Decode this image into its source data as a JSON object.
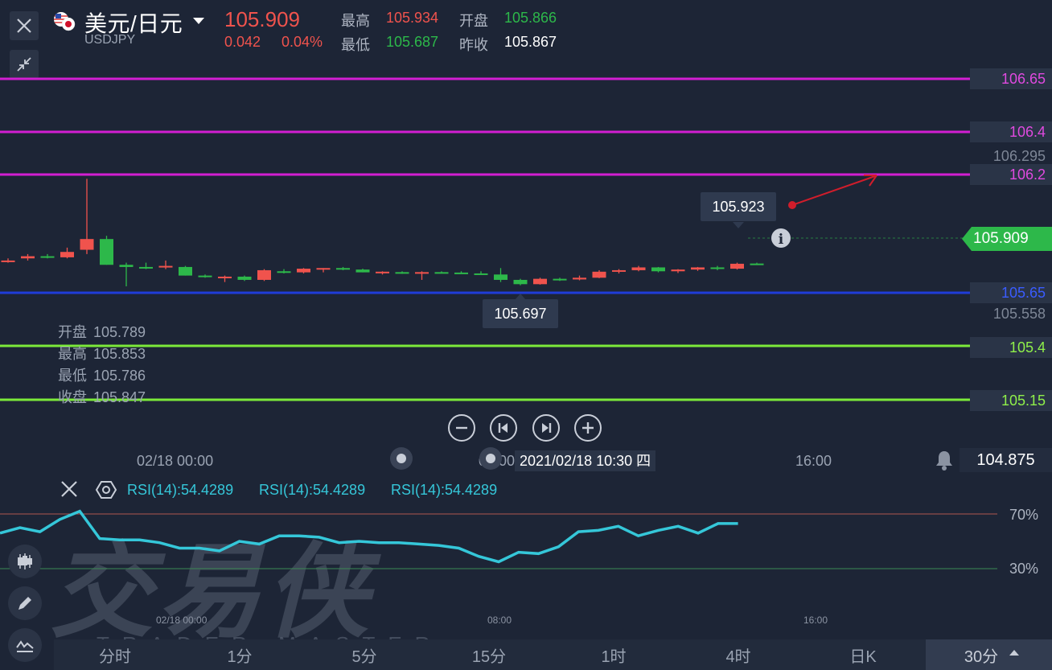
{
  "header": {
    "pair_name": "美元/日元",
    "symbol": "USDJPY",
    "last_price": "105.909",
    "change": "0.042",
    "change_pct": "0.04%",
    "high_label": "最高",
    "high_value": "105.934",
    "low_label": "最低",
    "low_value": "105.687",
    "open_label": "开盘",
    "open_value": "105.866",
    "prev_close_label": "昨收",
    "prev_close_value": "105.867"
  },
  "price_levels": [
    {
      "value": "106.65",
      "color": "#d21ed2",
      "text_color": "#e04ae0"
    },
    {
      "value": "106.4",
      "color": "#d21ed2",
      "text_color": "#e04ae0"
    },
    {
      "value": "106.2",
      "color": "#d21ed2",
      "text_color": "#e04ae0"
    },
    {
      "value": "105.65",
      "color": "#1f3cd8",
      "text_color": "#3a5cff"
    },
    {
      "value": "105.4",
      "color": "#7cea3a",
      "text_color": "#8ff04a"
    },
    {
      "value": "105.15",
      "color": "#7cea3a",
      "text_color": "#8ff04a"
    }
  ],
  "axis_values": {
    "upper": "106.295",
    "lower": "105.558"
  },
  "current_price_tag": "105.909",
  "high_bubble": "105.923",
  "low_bubble": "105.697",
  "ohlc_panel": {
    "open_label": "开盘",
    "open": "105.789",
    "high_label": "最高",
    "high": "105.853",
    "low_label": "最低",
    "low": "105.786",
    "close_label": "收盘",
    "close": "105.847"
  },
  "time_axis": {
    "t1": "02/18 00:00",
    "t2": "08:00",
    "t3": "16:00"
  },
  "cursor_time": "2021/02/18 10:30 四",
  "alert_price": "104.875",
  "rsi": {
    "label1": "RSI(14):54.4289",
    "label2": "RSI(14):54.4289",
    "label3": "RSI(14):54.4289",
    "level_high": "70%",
    "level_low": "30%",
    "line_color": "#35c7d9",
    "x_labels": {
      "t1": "02/18 00:00",
      "t2": "08:00",
      "t3": "16:00"
    }
  },
  "watermark": {
    "main": "交易侠",
    "sub": "TRADER MASTER"
  },
  "timeframes": [
    "分时",
    "1分",
    "5分",
    "15分",
    "1时",
    "4时",
    "日K"
  ],
  "active_timeframe": "30分",
  "colors": {
    "up": "#f0534d",
    "down": "#2db84a",
    "background": "#1d2536"
  },
  "candles": [
    {
      "o": 105.8,
      "h": 105.81,
      "l": 105.79,
      "c": 105.8,
      "up": true
    },
    {
      "o": 105.81,
      "h": 105.83,
      "l": 105.8,
      "c": 105.82,
      "up": true
    },
    {
      "o": 105.82,
      "h": 105.83,
      "l": 105.81,
      "c": 105.815,
      "up": false
    },
    {
      "o": 105.815,
      "h": 105.86,
      "l": 105.81,
      "c": 105.84,
      "up": true
    },
    {
      "o": 105.85,
      "h": 106.18,
      "l": 105.83,
      "c": 105.9,
      "up": true
    },
    {
      "o": 105.9,
      "h": 105.915,
      "l": 105.78,
      "c": 105.78,
      "up": false
    },
    {
      "o": 105.78,
      "h": 105.79,
      "l": 105.68,
      "c": 105.77,
      "up": false
    },
    {
      "o": 105.77,
      "h": 105.79,
      "l": 105.76,
      "c": 105.77,
      "up": false
    },
    {
      "o": 105.77,
      "h": 105.8,
      "l": 105.76,
      "c": 105.775,
      "up": true
    },
    {
      "o": 105.77,
      "h": 105.775,
      "l": 105.73,
      "c": 105.73,
      "up": false
    },
    {
      "o": 105.73,
      "h": 105.735,
      "l": 105.72,
      "c": 105.727,
      "up": false
    },
    {
      "o": 105.725,
      "h": 105.73,
      "l": 105.7,
      "c": 105.723,
      "up": true
    },
    {
      "o": 105.725,
      "h": 105.73,
      "l": 105.705,
      "c": 105.71,
      "up": false
    },
    {
      "o": 105.71,
      "h": 105.76,
      "l": 105.705,
      "c": 105.755,
      "up": true
    },
    {
      "o": 105.75,
      "h": 105.76,
      "l": 105.74,
      "c": 105.745,
      "up": false
    },
    {
      "o": 105.745,
      "h": 105.765,
      "l": 105.74,
      "c": 105.762,
      "up": true
    },
    {
      "o": 105.762,
      "h": 105.765,
      "l": 105.745,
      "c": 105.765,
      "up": true
    },
    {
      "o": 105.765,
      "h": 105.77,
      "l": 105.755,
      "c": 105.758,
      "up": false
    },
    {
      "o": 105.758,
      "h": 105.762,
      "l": 105.745,
      "c": 105.745,
      "up": false
    },
    {
      "o": 105.745,
      "h": 105.75,
      "l": 105.735,
      "c": 105.748,
      "up": true
    },
    {
      "o": 105.746,
      "h": 105.75,
      "l": 105.738,
      "c": 105.742,
      "up": false
    },
    {
      "o": 105.745,
      "h": 105.75,
      "l": 105.71,
      "c": 105.746,
      "up": true
    },
    {
      "o": 105.746,
      "h": 105.75,
      "l": 105.74,
      "c": 105.744,
      "up": false
    },
    {
      "o": 105.744,
      "h": 105.75,
      "l": 105.738,
      "c": 105.74,
      "up": false
    },
    {
      "o": 105.74,
      "h": 105.75,
      "l": 105.735,
      "c": 105.738,
      "up": false
    },
    {
      "o": 105.735,
      "h": 105.765,
      "l": 105.7,
      "c": 105.71,
      "up": false
    },
    {
      "o": 105.71,
      "h": 105.715,
      "l": 105.685,
      "c": 105.69,
      "up": false
    },
    {
      "o": 105.69,
      "h": 105.72,
      "l": 105.688,
      "c": 105.715,
      "up": true
    },
    {
      "o": 105.715,
      "h": 105.72,
      "l": 105.705,
      "c": 105.712,
      "up": false
    },
    {
      "o": 105.712,
      "h": 105.73,
      "l": 105.708,
      "c": 105.72,
      "up": true
    },
    {
      "o": 105.72,
      "h": 105.755,
      "l": 105.718,
      "c": 105.748,
      "up": true
    },
    {
      "o": 105.748,
      "h": 105.76,
      "l": 105.74,
      "c": 105.755,
      "up": true
    },
    {
      "o": 105.755,
      "h": 105.775,
      "l": 105.75,
      "c": 105.768,
      "up": true
    },
    {
      "o": 105.768,
      "h": 105.77,
      "l": 105.745,
      "c": 105.75,
      "up": false
    },
    {
      "o": 105.75,
      "h": 105.76,
      "l": 105.742,
      "c": 105.758,
      "up": true
    },
    {
      "o": 105.758,
      "h": 105.77,
      "l": 105.752,
      "c": 105.768,
      "up": true
    },
    {
      "o": 105.768,
      "h": 105.775,
      "l": 105.755,
      "c": 105.762,
      "up": false
    },
    {
      "o": 105.762,
      "h": 105.79,
      "l": 105.758,
      "c": 105.785,
      "up": true
    },
    {
      "o": 105.785,
      "h": 105.79,
      "l": 105.78,
      "c": 105.786,
      "up": false
    }
  ],
  "rsi_values": [
    56,
    60,
    57,
    66,
    72,
    52,
    51,
    51,
    49,
    45,
    45,
    43,
    50,
    48,
    54,
    54,
    53,
    49,
    50,
    49,
    49,
    48,
    47,
    45,
    39,
    35,
    42,
    41,
    46,
    57,
    58,
    61,
    54,
    58,
    61,
    56,
    63,
    63
  ]
}
